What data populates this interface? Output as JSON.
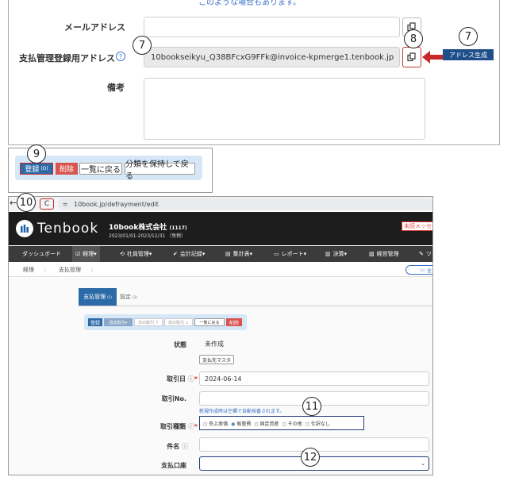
{
  "top_panel": {
    "cut_text": "このような場合もあります。",
    "email_label": "メールアドレス",
    "email_value": "",
    "payment_label": "支払管理登録用アドレス",
    "payment_help": "?",
    "payment_value": "10bookseikyu_Q38BFcxG9FFk@invoice-kpmerge1.tenbook.jp",
    "notes_label": "備考",
    "notes_value": "",
    "address_gen_label": "アドレス生成"
  },
  "callouts": {
    "c7a": "7",
    "c7b": "7",
    "c8": "8",
    "c9": "9",
    "c10": "10",
    "c11": "11",
    "c12": "12"
  },
  "button_bar": {
    "register": "登録",
    "register_key": "(D)",
    "delete": "削除",
    "back_list": "一覧に戻る",
    "back_keep": "分類を保持して戻る"
  },
  "browser": {
    "back_arrow": "←",
    "reload": "C",
    "url": "10book.jp/defrayment/edit"
  },
  "app": {
    "logo": "Tenbook",
    "company": "10book株式会社",
    "company_code": "(1117)",
    "period": "2023/01/01-2023/12/31 （免税）",
    "unread": "未読メッセー",
    "nav": [
      "ダッシュボード",
      "経理▾",
      "社員管理▾",
      "会計記録▾",
      "集計表▾",
      "レポート▾",
      "決算▾",
      "経営管理",
      "ツ"
    ],
    "breadcrumb": [
      "経理",
      "支払管理"
    ],
    "breadcrumb_btn": "全",
    "tabs": [
      "支払管理",
      "設定"
    ],
    "tab_key_main": "(1)",
    "tab_key_settings": "(2)",
    "toolbar": {
      "register": "登録",
      "past": "過去取引▾",
      "next": "次の取引 ↑",
      "prev": "前の取引 ↓",
      "back_list": "一覧に戻る",
      "delete": "削除"
    },
    "form": {
      "status_label": "状態",
      "status_value": "未作成",
      "master_btn": "支払先マスタ",
      "date_label": "取引日",
      "date_value": "2024-06-14",
      "no_label": "取引No.",
      "no_value": "",
      "no_hint": "新規作成時は空欄で自動採番されます。",
      "type_label": "取引種類",
      "types": [
        "売上原価",
        "販管費",
        "固定資産",
        "その他",
        "仕訳なし"
      ],
      "type_selected": "販管費",
      "subject_label": "件名",
      "subject_value": "",
      "account_label": "支払口座",
      "account_value": ""
    }
  }
}
